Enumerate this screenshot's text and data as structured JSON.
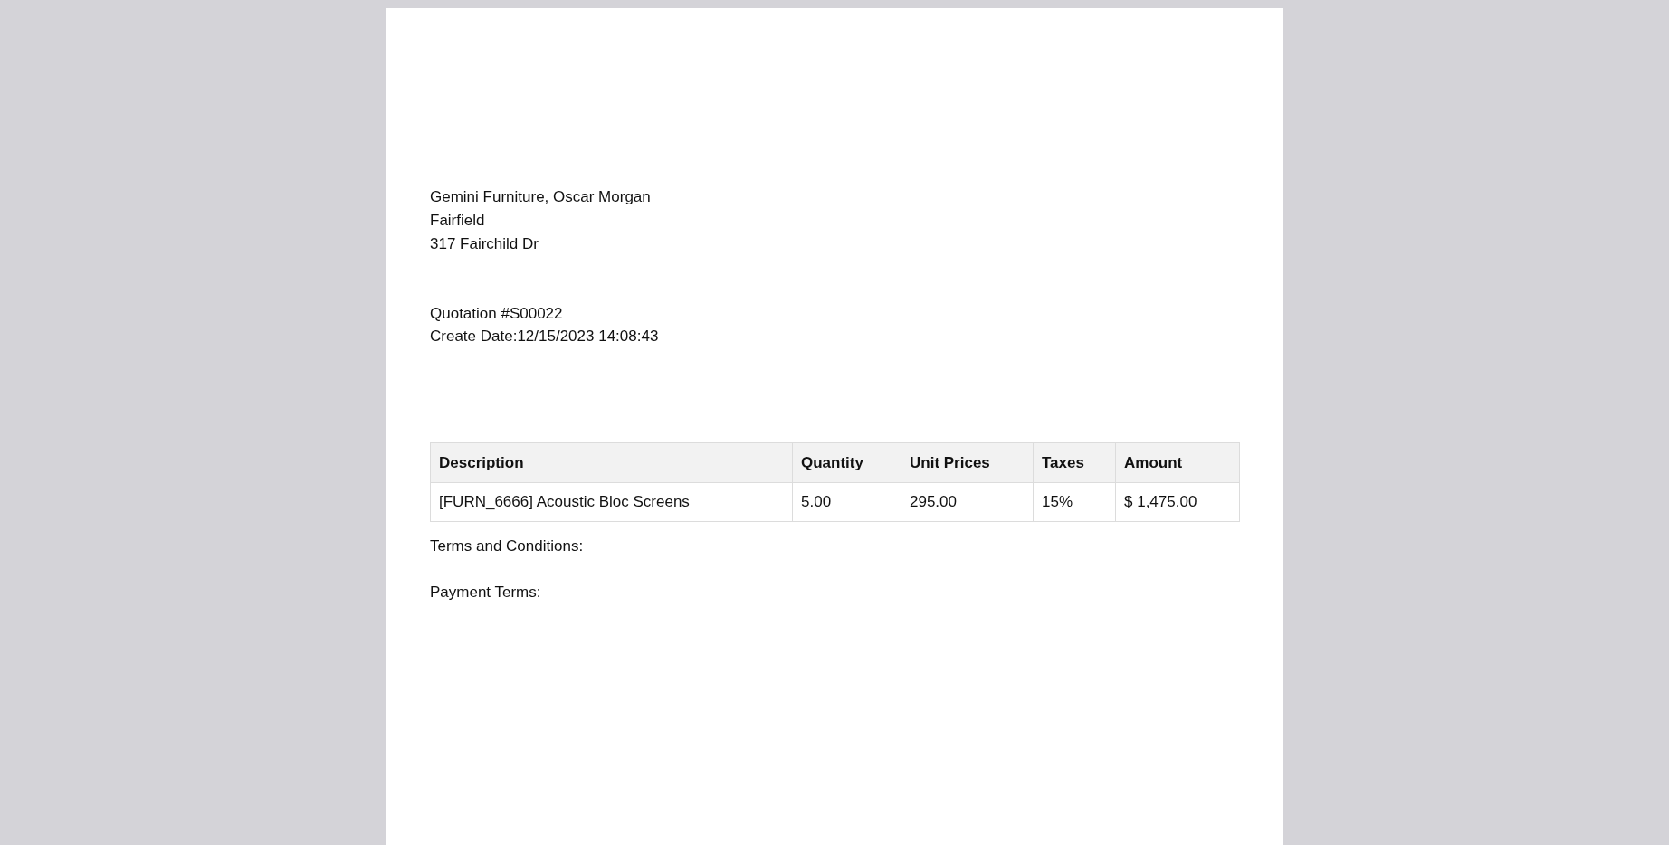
{
  "address": [
    "Gemini Furniture, Oscar Morgan",
    "Fairfield",
    "317 Fairchild Dr"
  ],
  "quotation": {
    "title": "Quotation #S00022",
    "create_date": "Create Date:12/15/2023 14:08:43"
  },
  "table": {
    "columns": [
      "Description",
      "Quantity",
      "Unit Prices",
      "Taxes",
      "Amount"
    ],
    "rows": [
      [
        "[FURN_6666] Acoustic Bloc Screens",
        "5.00",
        "295.00",
        "15%",
        "$ 1,475.00"
      ]
    ]
  },
  "terms": "Terms and Conditions:",
  "payment_terms": "Payment Terms:"
}
